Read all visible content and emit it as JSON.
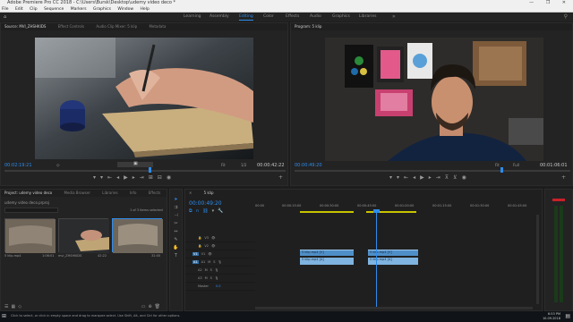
{
  "app": {
    "title": "Adobe Premiere Pro CC 2018 - C:\\Users\\Bursk\\Desktop\\udemy video deco *",
    "window_controls": "—  ❐  ✕"
  },
  "menu": [
    "File",
    "Edit",
    "Clip",
    "Sequence",
    "Markers",
    "Graphics",
    "Window",
    "Help"
  ],
  "workspaces": [
    {
      "label": "Learning",
      "active": false
    },
    {
      "label": "Assembly",
      "active": false
    },
    {
      "label": "Editing",
      "active": true
    },
    {
      "label": "Color",
      "active": false
    },
    {
      "label": "Effects",
      "active": false
    },
    {
      "label": "Audio",
      "active": false
    },
    {
      "label": "Graphics",
      "active": false
    },
    {
      "label": "Libraries",
      "active": false
    }
  ],
  "source": {
    "tabs": [
      "Source: MVI_ZHSHKIDS",
      "Effect Controls",
      "Audio Clip Mixer: 5 klip",
      "Metadata"
    ],
    "timecode_left": "00:02:19:21",
    "timecode_right": "00:00:42:22",
    "fit": "Fit",
    "zoom": "1/2"
  },
  "program": {
    "tab": "Program: 5 klip",
    "timecode_left": "00:00:49:20",
    "timecode_right": "00:01:06:01",
    "fit": "Fit",
    "zoom": "Full"
  },
  "project": {
    "tabs": [
      "Project: udemy video deco",
      "Media Browser",
      "Libraries",
      "Info",
      "Effects"
    ],
    "file_name": "udemy video deco.prproj",
    "selection_info": "1 of 3 items selected",
    "items": [
      {
        "name": "5 klip.mp4",
        "duration": "1:06:01"
      },
      {
        "name": "mvi_ZHSHKIDS",
        "duration": "42:22"
      },
      {
        "name": "",
        "duration": "32:00"
      }
    ]
  },
  "timeline": {
    "tab": "5 klip",
    "timecode": "00:00:49:20",
    "ruler": [
      "00:00",
      "00:00:15:00",
      "00:00:30:00",
      "00:00:45:00",
      "00:01:00:00",
      "00:01:15:00",
      "00:01:30:00",
      "00:01:45:00"
    ],
    "tracks": [
      "V3",
      "V2",
      "V1",
      "A1",
      "A2",
      "A3"
    ],
    "master": "Master",
    "master_value": "0.0",
    "clips": [
      {
        "label": "5 klip.mp4 [V]",
        "track": "V1"
      },
      {
        "label": "5 klip.mp4 [V]",
        "track": "V1"
      },
      {
        "label": "5 klip.mp4 [A]",
        "track": "A1"
      },
      {
        "label": "5 klip.mp4 [A]",
        "track": "A1"
      }
    ]
  },
  "status": {
    "message": "Click to select, or click in empty space and drag to marquee select. Use Shift, Alt, and Ctrl for other options.",
    "clock": "6:53 PM",
    "date": "10.09.2018"
  },
  "colors": {
    "accent": "#2d8ceb",
    "clip_video": "#4f8fc8",
    "clip_audio": "#7fb3e0",
    "work_area": "#c8c400"
  }
}
